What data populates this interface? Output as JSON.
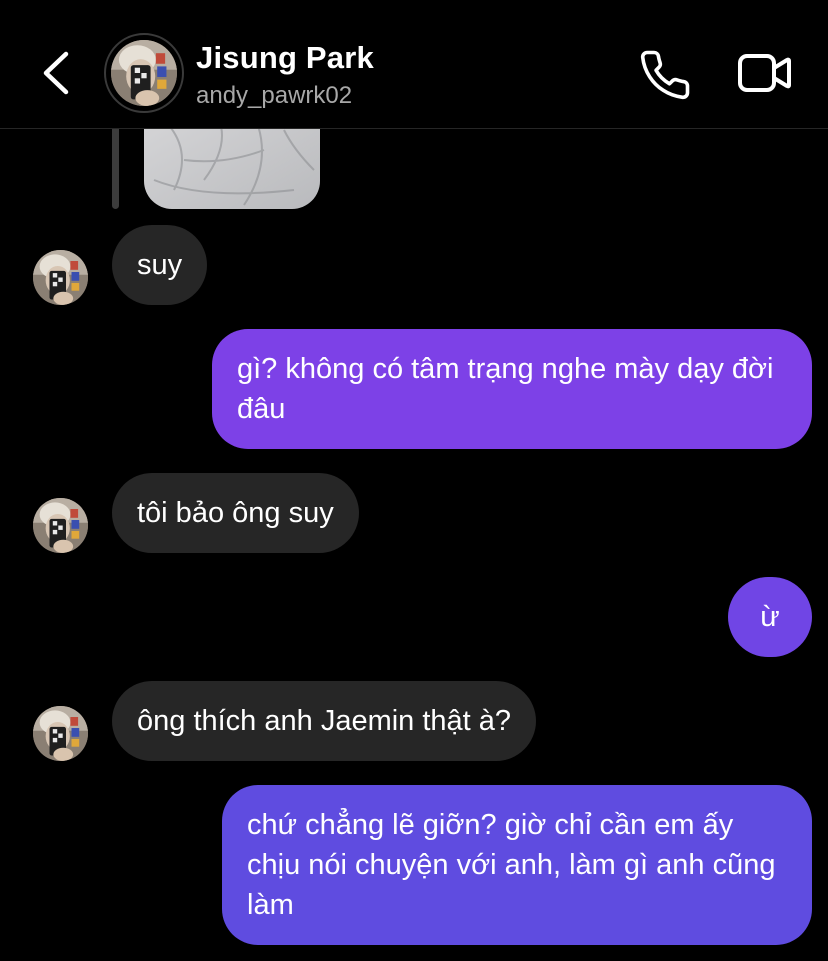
{
  "header": {
    "name": "Jisung Park",
    "username": "andy_pawrk02"
  },
  "icons": {
    "back": "chevron-left-icon",
    "call": "phone-icon",
    "video": "video-camera-icon"
  },
  "colors": {
    "background": "#000000",
    "received_bubble": "#262626",
    "sent_bubble_top": "#7e40e6",
    "sent_bubble_bottom": "#5c4be0",
    "secondary_text": "#a8a8a8"
  },
  "messages": [
    {
      "from": "them",
      "type": "image"
    },
    {
      "from": "them",
      "text": "suy"
    },
    {
      "from": "me",
      "text": "gì? không có tâm trạng nghe mày dạy đời đâu"
    },
    {
      "from": "them",
      "text": "tôi bảo ông suy"
    },
    {
      "from": "me",
      "text": "ừ"
    },
    {
      "from": "them",
      "text": "ông thích anh Jaemin thật à?"
    },
    {
      "from": "me",
      "text": "chứ chẳng lẽ giỡn? giờ chỉ cần em ấy chịu nói chuyện với anh, làm gì anh cũng làm"
    }
  ]
}
